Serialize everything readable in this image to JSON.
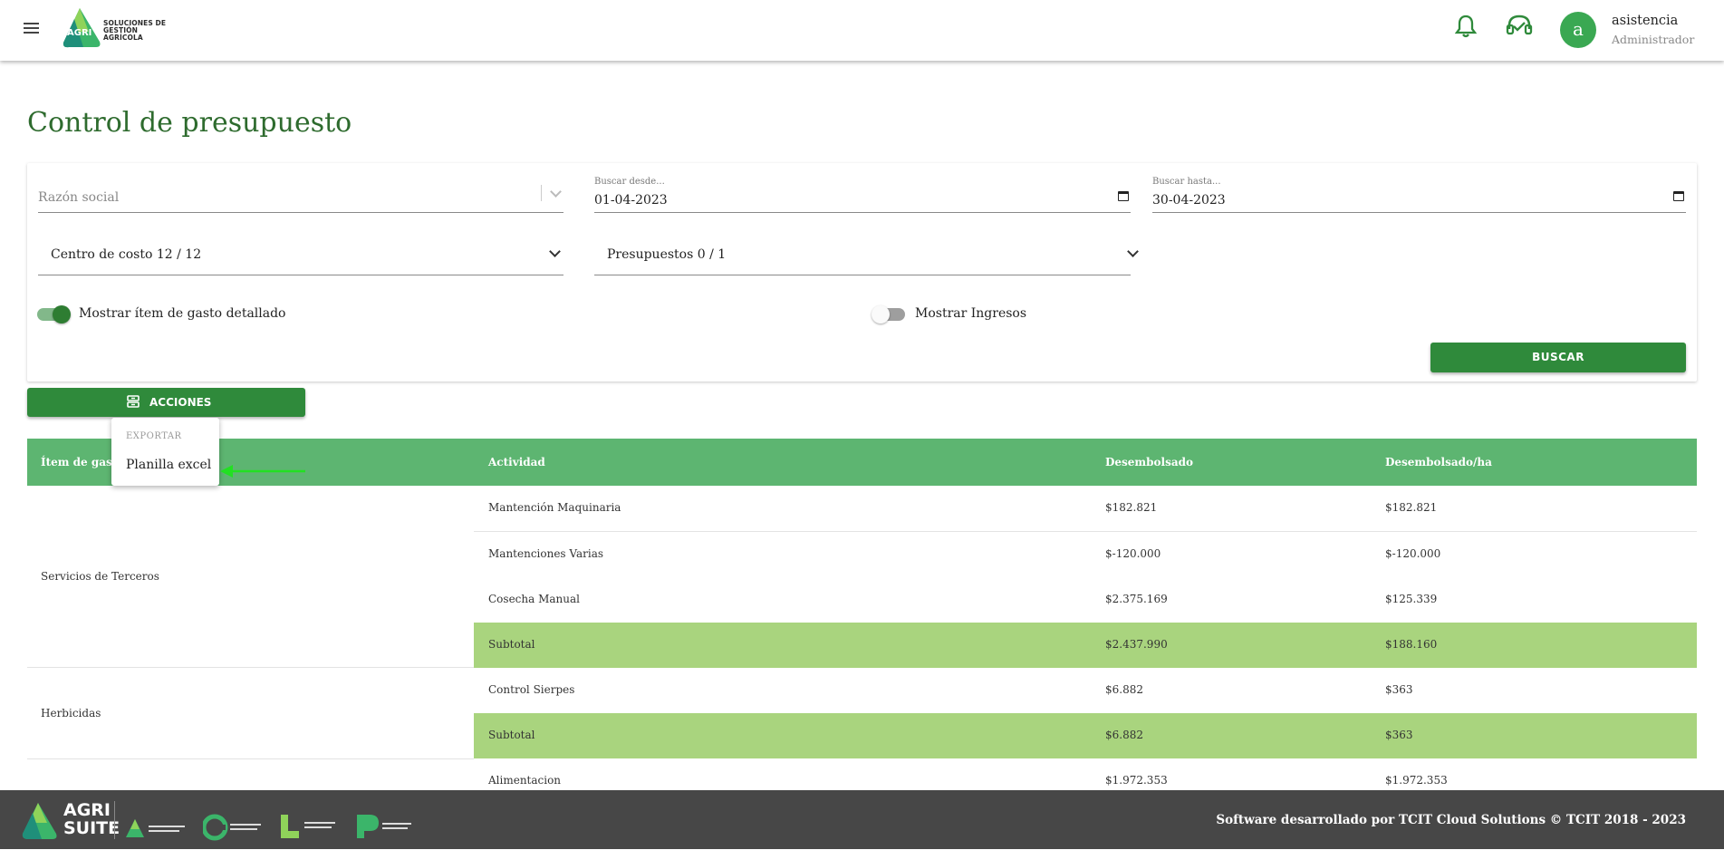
{
  "header": {
    "logo_text_line1": "SOLUCIONES DE",
    "logo_text_line2": "GESTIÓN AGRÍCOLA",
    "logo_mark_text": "AGRI",
    "user_initial": "a",
    "user_name": "asistencia",
    "user_role": "Administrador"
  },
  "page_title": "Control de presupuesto",
  "filters": {
    "razon_social_placeholder": "Razón social",
    "desde_label": "Buscar desde...",
    "desde_value": "01-04-2023",
    "hasta_label": "Buscar hasta...",
    "hasta_value": "30-04-2023",
    "centro_costo": "Centro de costo 12 / 12",
    "presupuestos": "Presupuestos 0 / 1",
    "toggle_detallado_label": "Mostrar ítem de gasto detallado",
    "toggle_detallado_on": true,
    "toggle_ingresos_label": "Mostrar Ingresos",
    "toggle_ingresos_on": false,
    "buscar_label": "BUSCAR"
  },
  "acciones": {
    "label": "ACCIONES",
    "menu_section": "EXPORTAR",
    "menu_item": "Planilla excel"
  },
  "table": {
    "headers": [
      "Ítem de gasto",
      "Actividad",
      "Desembolsado",
      "Desembolsado/ha"
    ],
    "groups": [
      {
        "item": "Servicios de Terceros",
        "rows": [
          {
            "actividad": "Mantención Maquinaria",
            "desembolsado": "$182.821",
            "ha": "$182.821"
          },
          {
            "actividad": "Mantenciones Varias",
            "desembolsado": "$-120.000",
            "ha": "$-120.000"
          },
          {
            "actividad": "Cosecha Manual",
            "desembolsado": "$2.375.169",
            "ha": "$125.339"
          },
          {
            "actividad": "Subtotal",
            "desembolsado": "$2.437.990",
            "ha": "$188.160"
          }
        ]
      },
      {
        "item": "Herbicidas",
        "rows": [
          {
            "actividad": "Control Sierpes",
            "desembolsado": "$6.882",
            "ha": "$363"
          },
          {
            "actividad": "Subtotal",
            "desembolsado": "$6.882",
            "ha": "$363"
          }
        ]
      },
      {
        "item": "",
        "rows": [
          {
            "actividad": "Alimentacion",
            "desembolsado": "$1.972.353",
            "ha": "$1.972.353"
          }
        ]
      }
    ]
  },
  "footer": {
    "brand_line1": "AGRI",
    "brand_line2": "SUITE",
    "text": "Software desarrollado por TCIT Cloud Solutions © TCIT 2018 - 2023"
  },
  "colors": {
    "primary": "#2f8a3b",
    "header_row": "#5db571",
    "subtotal_row": "#a9d47e",
    "title": "#2e6b2e",
    "footer": "#474747"
  }
}
